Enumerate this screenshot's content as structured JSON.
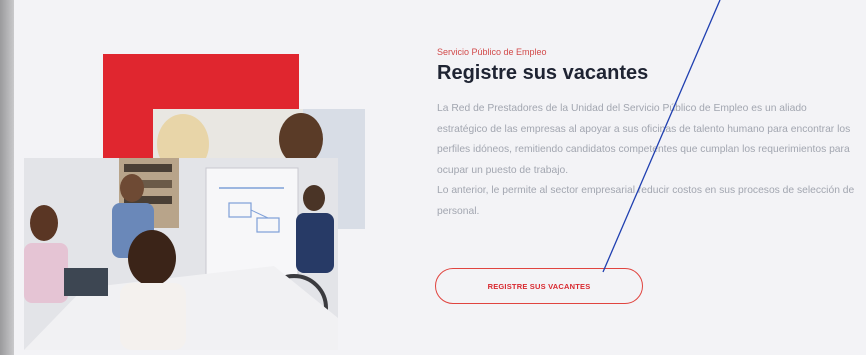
{
  "section": {
    "subtitle": "Servicio Público de Empleo",
    "title": "Registre sus vacantes",
    "paragraph1": "La Red de Prestadores de la Unidad del Servicio Público de Empleo es un aliado estratégico de las empresas al apoyar a sus oficinas de talento humano para encontrar los perfiles idóneos, remitiendo candidatos competentes que cumplan los requerimientos para ocupar un puesto de trabajo.",
    "paragraph2": "Lo anterior, le permite al sector empresarial reducir costos en sus procesos de selección de personal.",
    "cta_label": "REGISTRE SUS VACANTES"
  },
  "colors": {
    "accent_red": "#e0262f",
    "title": "#1f2433",
    "body_text": "#a2a6b0",
    "annotation_line": "#1f3fb0"
  }
}
